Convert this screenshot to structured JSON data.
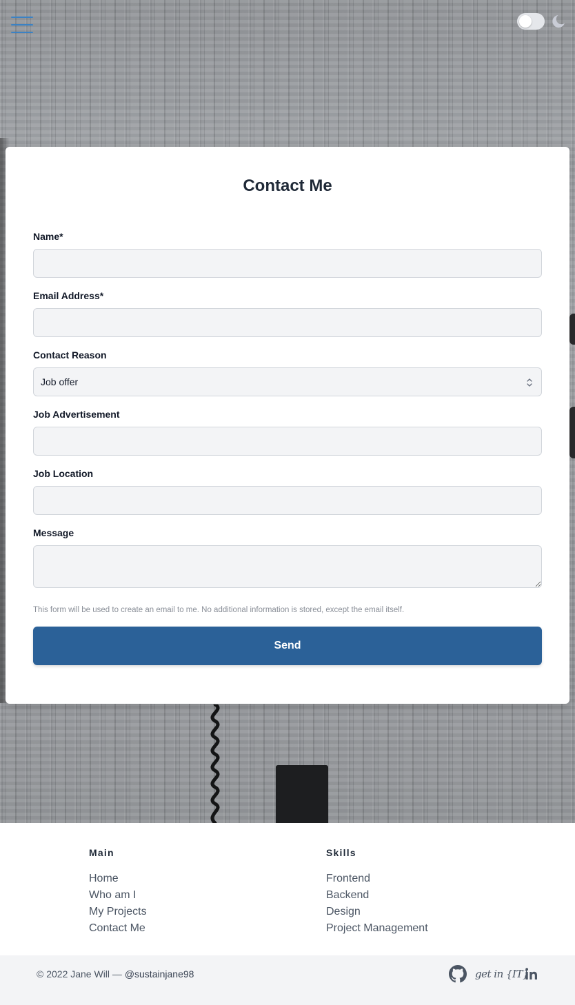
{
  "header": {
    "menu_icon": "hamburger-menu-icon",
    "theme_toggle_state": "off",
    "theme_icon": "moon-icon"
  },
  "form": {
    "title": "Contact Me",
    "fields": {
      "name": {
        "label": "Name*",
        "value": ""
      },
      "email": {
        "label": "Email Address*",
        "value": ""
      },
      "reason": {
        "label": "Contact Reason",
        "value": "Job offer"
      },
      "job_ad": {
        "label": "Job Advertisement",
        "value": ""
      },
      "job_location": {
        "label": "Job Location",
        "value": ""
      },
      "message": {
        "label": "Message",
        "value": ""
      }
    },
    "note": "This form will be used to create an email to me. No additional information is stored, except the email itself.",
    "submit_label": "Send"
  },
  "footer": {
    "main": {
      "heading": "Main",
      "items": [
        "Home",
        "Who am I",
        "My Projects",
        "Contact Me"
      ]
    },
    "skills": {
      "heading": "Skills",
      "items": [
        "Frontend",
        "Backend",
        "Design",
        "Project Management"
      ]
    },
    "copyright_prefix": "© 2022 Jane Will — ",
    "handle": "@sustainjane98",
    "social": {
      "github_icon": "github-icon",
      "getin_logo": "get in {IT}",
      "linkedin_icon": "linkedin-icon"
    }
  },
  "colors": {
    "accent": "#2b6198",
    "menu_icon": "#3b82c4",
    "card_bg": "#ffffff",
    "input_bg": "#f3f4f6"
  }
}
